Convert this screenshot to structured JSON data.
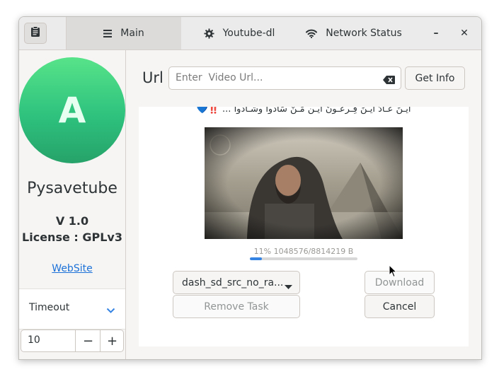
{
  "header": {
    "tabs": [
      {
        "label": "Main",
        "icon": "menu-icon",
        "active": true
      },
      {
        "label": "Youtube-dl",
        "icon": "gear-icon",
        "active": false
      },
      {
        "label": "Network Status",
        "icon": "wifi-icon",
        "active": false
      }
    ],
    "minimize_label": "–",
    "close_label": "✕"
  },
  "sidebar": {
    "avatar_letter": "A",
    "app_name": "Pysavetube",
    "version": "V 1.0",
    "license": "License : GPLv3",
    "website_label": "WebSite",
    "timeout_label": "Timeout",
    "timeout_value": "10",
    "minus_label": "−",
    "plus_label": "+"
  },
  "main": {
    "url_label": "Url",
    "url_placeholder": "Enter  Video Url...",
    "url_value": "",
    "get_info_label": "Get Info",
    "video_title": "ايـنَ عـادُ ايـنَ فِـرعَـونَ ايـن مَـنْ سَادوا وشـادوا ... ‼️💙",
    "progress_text": "11% 1048576/8814219 B",
    "progress_percent": 11,
    "format_selected": "dash_sd_src_no_ra...",
    "remove_task_label": "Remove Task",
    "download_label": "Download",
    "cancel_label": "Cancel"
  },
  "colors": {
    "accent": "#3584e4",
    "avatar_green": "#2ec27e",
    "link": "#1c71d8"
  }
}
